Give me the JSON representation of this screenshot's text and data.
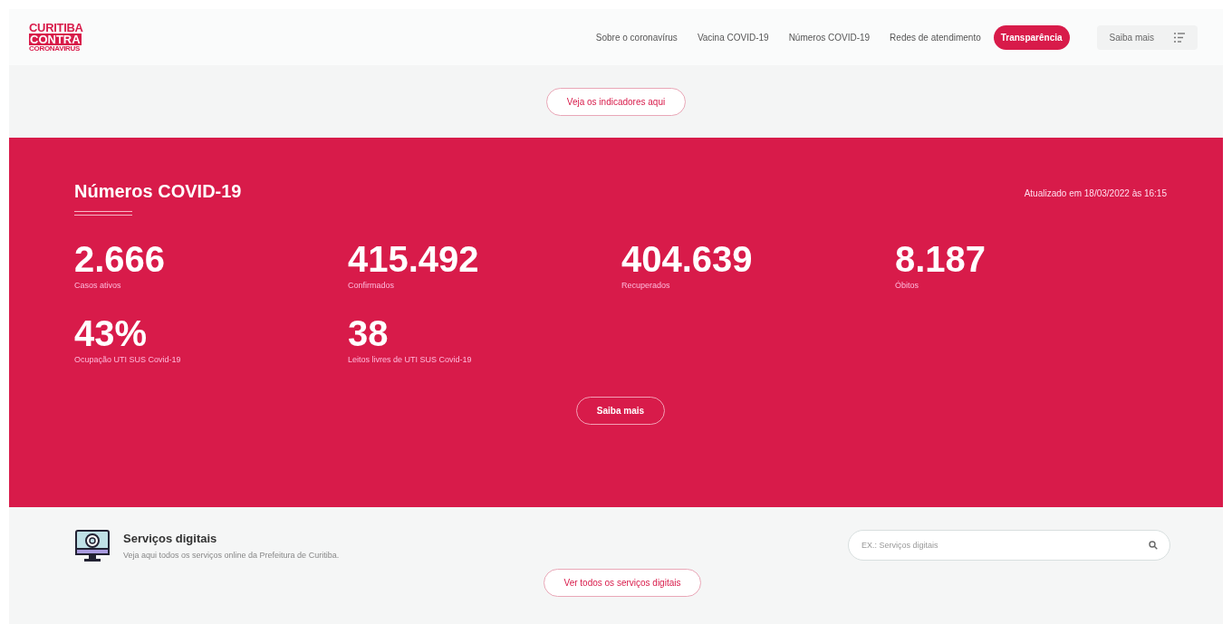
{
  "logo": {
    "line_1": "CURITIBA",
    "line_2": "CONTRA",
    "line_3": "CORONAVIRUS"
  },
  "nav": [
    {
      "label": "Sobre o coronavírus",
      "selected": false
    },
    {
      "label": "Vacina COVID-19",
      "selected": false
    },
    {
      "label": "Números COVID-19",
      "selected": false
    },
    {
      "label": "Redes de atendimento",
      "selected": false
    },
    {
      "label": "Transparência",
      "selected": true
    }
  ],
  "menu_button": {
    "label": "Saiba mais"
  },
  "indicators_button": "Veja os indicadores aqui",
  "covid": {
    "title": "Números COVID-19",
    "updated": "Atualizado em 18/03/2022 às 16:15",
    "stats": [
      {
        "value": "2.666",
        "label": "Casos ativos"
      },
      {
        "value": "415.492",
        "label": "Confirmados"
      },
      {
        "value": "404.639",
        "label": "Recuperados"
      },
      {
        "value": "8.187",
        "label": "Óbitos"
      },
      {
        "value": "43%",
        "label": "Ocupação UTI SUS Covid-19"
      },
      {
        "value": "38",
        "label": "Leitos livres de UTI SUS Covid-19"
      }
    ],
    "button": "Saiba mais"
  },
  "services": {
    "title": "Serviços digitais",
    "description": "Veja aqui todos os serviços online da Prefeitura de Curitiba.",
    "search": {
      "placeholder": "EX.: Serviços digitais"
    },
    "button": "Ver todos os serviços digitais"
  }
}
